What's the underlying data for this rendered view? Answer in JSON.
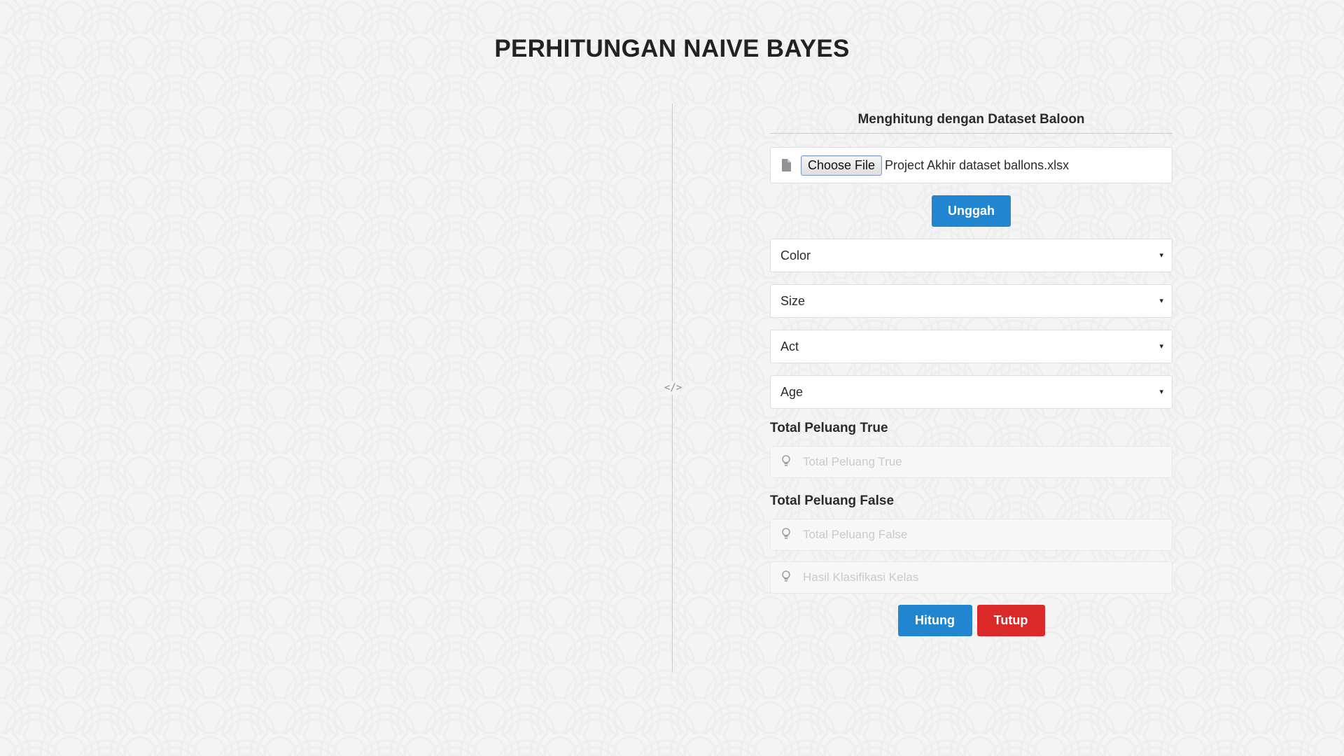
{
  "page": {
    "title": "PERHITUNGAN NAIVE BAYES"
  },
  "divider": {
    "icon": "code-icon",
    "glyph": "</>"
  },
  "form": {
    "heading": "Menghitung dengan Dataset Baloon",
    "file": {
      "icon": "file-icon",
      "button_label": "Choose File",
      "selected_name": "Project Akhir dataset ballons.xlsx"
    },
    "upload_label": "Unggah",
    "selects": [
      {
        "value": "Color"
      },
      {
        "value": "Size"
      },
      {
        "value": "Act"
      },
      {
        "value": "Age"
      }
    ],
    "caret_glyph": "▾",
    "total_true": {
      "label": "Total Peluang True",
      "placeholder": "Total Peluang True",
      "icon": "lightbulb-icon"
    },
    "total_false": {
      "label": "Total Peluang False",
      "placeholder": "Total Peluang False",
      "icon": "lightbulb-icon"
    },
    "result": {
      "placeholder": "Hasil Klasifikasi Kelas",
      "icon": "lightbulb-icon"
    },
    "calculate_label": "Hitung",
    "close_label": "Tutup"
  },
  "colors": {
    "primary_blue": "#2185d0",
    "danger_red": "#db2828",
    "background": "#f4f4f5"
  }
}
